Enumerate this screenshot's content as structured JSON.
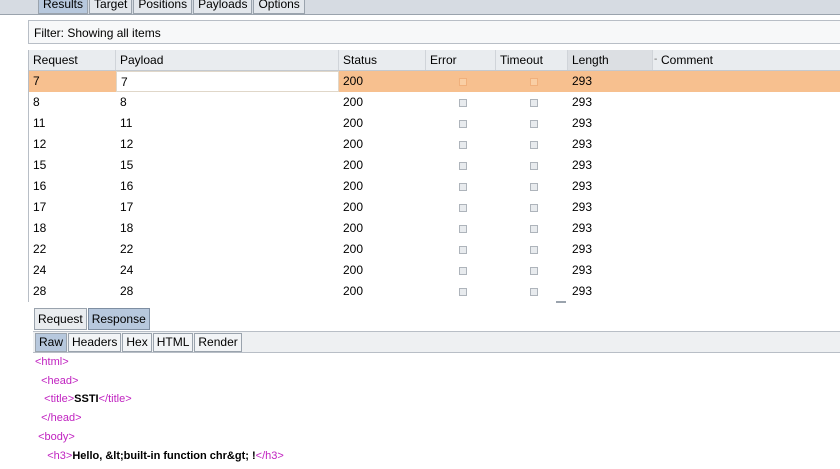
{
  "top_tabs": [
    "Results",
    "Target",
    "Positions",
    "Payloads",
    "Options"
  ],
  "filter_text": "Filter: Showing all items",
  "columns": [
    "Request",
    "Payload",
    "Status",
    "Error",
    "Timeout",
    "Length",
    "Comment"
  ],
  "rows": [
    {
      "request": "7",
      "payload": "7",
      "status": "200",
      "length": "293",
      "selected": true
    },
    {
      "request": "8",
      "payload": "8",
      "status": "200",
      "length": "293"
    },
    {
      "request": "11",
      "payload": "11",
      "status": "200",
      "length": "293"
    },
    {
      "request": "12",
      "payload": "12",
      "status": "200",
      "length": "293"
    },
    {
      "request": "15",
      "payload": "15",
      "status": "200",
      "length": "293"
    },
    {
      "request": "16",
      "payload": "16",
      "status": "200",
      "length": "293"
    },
    {
      "request": "17",
      "payload": "17",
      "status": "200",
      "length": "293"
    },
    {
      "request": "18",
      "payload": "18",
      "status": "200",
      "length": "293"
    },
    {
      "request": "22",
      "payload": "22",
      "status": "200",
      "length": "293"
    },
    {
      "request": "24",
      "payload": "24",
      "status": "200",
      "length": "293"
    },
    {
      "request": "28",
      "payload": "28",
      "status": "200",
      "length": "293"
    }
  ],
  "reqresp_tabs": [
    "Request",
    "Response"
  ],
  "view_tabs": [
    "Raw",
    "Headers",
    "Hex",
    "HTML",
    "Render"
  ],
  "code_lines": [
    {
      "parts": [
        {
          "t": "<html>",
          "c": "tag"
        }
      ]
    },
    {
      "parts": [
        {
          "t": "  ",
          "c": ""
        },
        {
          "t": "<head>",
          "c": "tag"
        }
      ]
    },
    {
      "parts": [
        {
          "t": "   ",
          "c": ""
        },
        {
          "t": "<title>",
          "c": "tag"
        },
        {
          "t": "SSTI",
          "c": "bold"
        },
        {
          "t": "</title>",
          "c": "tag"
        }
      ]
    },
    {
      "parts": [
        {
          "t": "  ",
          "c": ""
        },
        {
          "t": "</head>",
          "c": "tag"
        }
      ]
    },
    {
      "parts": [
        {
          "t": " ",
          "c": ""
        },
        {
          "t": "<body>",
          "c": "tag"
        }
      ]
    },
    {
      "parts": [
        {
          "t": "    ",
          "c": ""
        },
        {
          "t": "<h3>",
          "c": "tag"
        },
        {
          "t": "Hello, &lt;built-in function chr&gt; !",
          "c": "bold"
        },
        {
          "t": "</h3>",
          "c": "tag"
        }
      ]
    }
  ],
  "colors": {
    "selected_row": "#f7c08f",
    "tag": "#c022c0",
    "active_tab": "#b7c8dd"
  }
}
